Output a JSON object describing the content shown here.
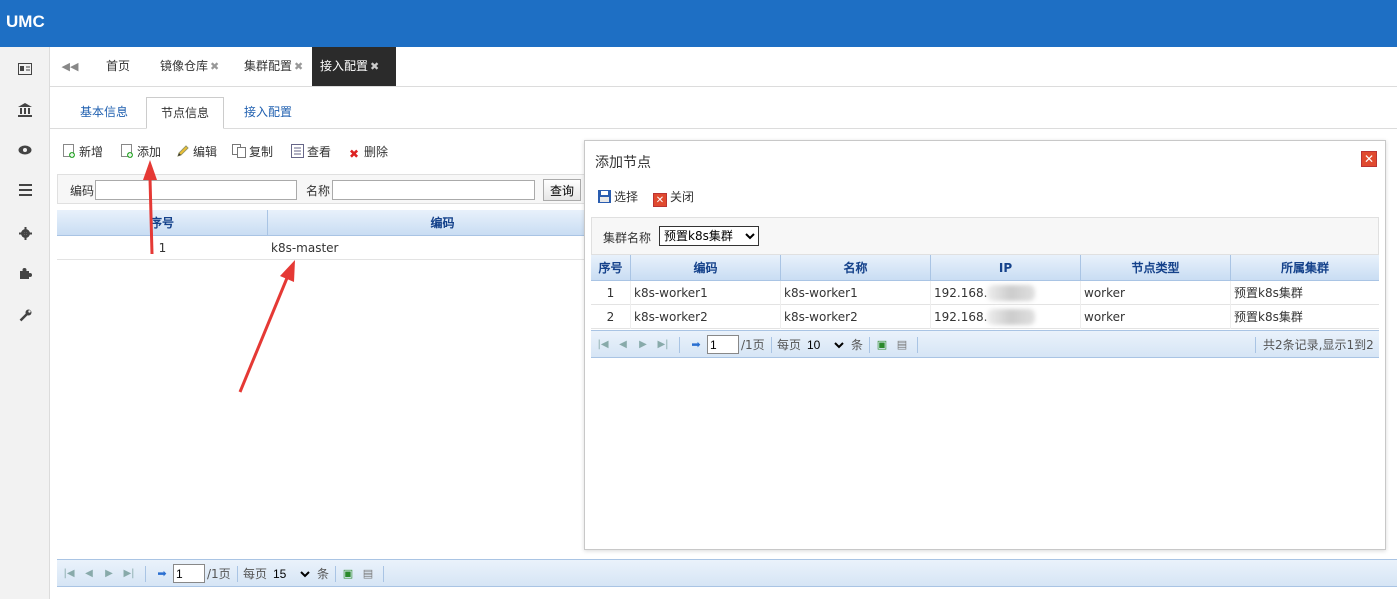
{
  "app": {
    "logo": "UMC"
  },
  "sidebar": {
    "icons": [
      "id-card-icon",
      "bank-icon",
      "eye-icon",
      "list-icon",
      "gear-icon",
      "puzzle-icon",
      "wrench-icon"
    ]
  },
  "tabs": {
    "back_icon": "double-left-icon",
    "items": [
      {
        "label": "首页",
        "closable": false
      },
      {
        "label": "镜像仓库",
        "closable": true
      },
      {
        "label": "集群配置",
        "closable": true
      },
      {
        "label": "接入配置",
        "closable": true,
        "active": true
      }
    ],
    "close_glyph": "✖"
  },
  "subtabs": [
    {
      "label": "基本信息"
    },
    {
      "label": "节点信息",
      "active": true
    },
    {
      "label": "接入配置"
    }
  ],
  "toolbar": {
    "new": "新增",
    "add": "添加",
    "edit": "编辑",
    "copy": "复制",
    "view": "查看",
    "delete": "删除"
  },
  "search": {
    "code_label": "编码",
    "name_label": "名称",
    "query_button": "查询",
    "code_value": "",
    "name_value": ""
  },
  "main_grid": {
    "columns": [
      "序号",
      "编码"
    ],
    "rows": [
      {
        "index": "1",
        "code": "k8s-master"
      }
    ]
  },
  "main_pager": {
    "page": "1",
    "total_pages": "/1页",
    "per_page_label": "每页",
    "per_page": "15",
    "unit": "条"
  },
  "dialog": {
    "title": "添加节点",
    "close_glyph": "✕",
    "select_button": "选择",
    "close_button": "关闭",
    "filter_label": "集群名称",
    "cluster_selected": "预置k8s集群",
    "columns": [
      "序号",
      "编码",
      "名称",
      "IP",
      "节点类型",
      "所属集群"
    ],
    "rows": [
      {
        "index": "1",
        "code": "k8s-worker1",
        "name": "k8s-worker1",
        "ip": "192.168.",
        "type": "worker",
        "cluster": "预置k8s集群"
      },
      {
        "index": "2",
        "code": "k8s-worker2",
        "name": "k8s-worker2",
        "ip": "192.168.",
        "type": "worker",
        "cluster": "预置k8s集群"
      }
    ],
    "pager": {
      "page": "1",
      "total_pages": "/1页",
      "per_page_label": "每页",
      "per_page": "10",
      "unit": "条",
      "summary": "共2条记录,显示1到2"
    }
  },
  "colors": {
    "topbar": "#1e6fc4",
    "active_tab": "#2b2b2b",
    "arrow": "#e53935",
    "grid_header_text": "#15428b"
  }
}
